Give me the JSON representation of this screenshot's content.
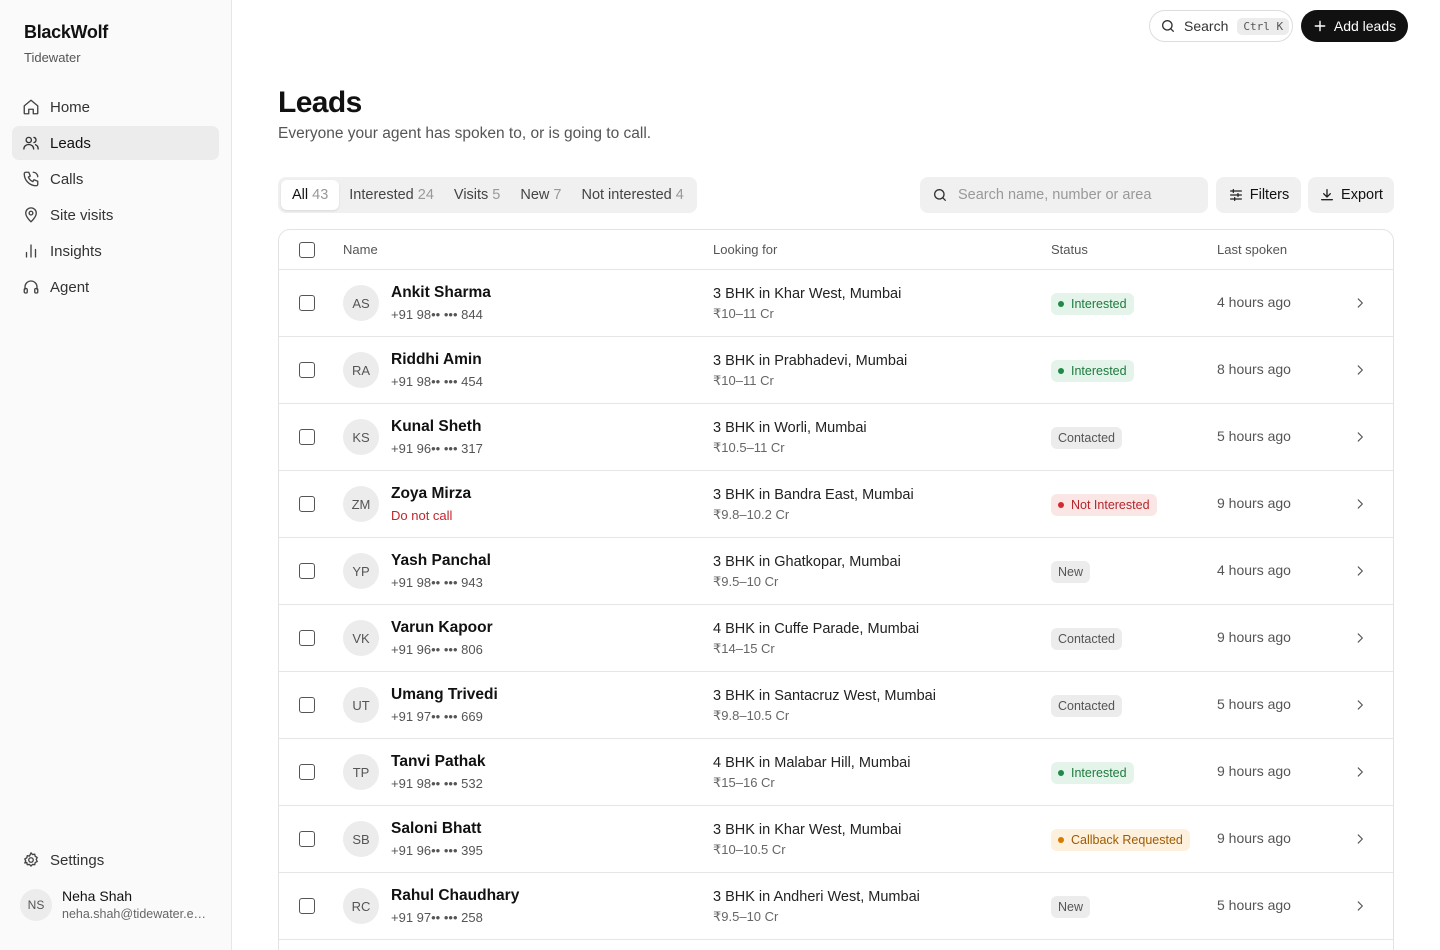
{
  "sidebar": {
    "brand": "BlackWolf",
    "org": "Tidewater",
    "items": [
      {
        "label": "Home",
        "icon": "home-icon"
      },
      {
        "label": "Leads",
        "icon": "users-icon",
        "active": true
      },
      {
        "label": "Calls",
        "icon": "phone-icon"
      },
      {
        "label": "Site visits",
        "icon": "map-pin-icon"
      },
      {
        "label": "Insights",
        "icon": "bar-chart-icon"
      },
      {
        "label": "Agent",
        "icon": "headset-icon"
      }
    ],
    "settings_label": "Settings",
    "user": {
      "initials": "NS",
      "name": "Neha Shah",
      "email": "neha.shah@tidewater.example"
    }
  },
  "topbar": {
    "search_label": "Search",
    "search_shortcut": "Ctrl K",
    "add_label": "Add leads"
  },
  "header": {
    "title": "Leads",
    "subtitle": "Everyone your agent has spoken to, or is going to call."
  },
  "tabs": [
    {
      "label": "All",
      "count": "43",
      "active": true
    },
    {
      "label": "Interested",
      "count": "24"
    },
    {
      "label": "Visits",
      "count": "5"
    },
    {
      "label": "New",
      "count": "7"
    },
    {
      "label": "Not interested",
      "count": "4"
    }
  ],
  "toolbar": {
    "search_placeholder": "Search name, number or area",
    "filters_label": "Filters",
    "export_label": "Export"
  },
  "table": {
    "columns": {
      "name": "Name",
      "looking": "Looking for",
      "status": "Status",
      "last": "Last spoken"
    },
    "rows": [
      {
        "initials": "AS",
        "name": "Ankit Sharma",
        "phone": "+91 98•• ••• 844",
        "looking": "3 BHK in Khar West, Mumbai",
        "budget": "₹10–11 Cr",
        "status": "Interested",
        "status_type": "interested",
        "last": "4 hours ago"
      },
      {
        "initials": "RA",
        "name": "Riddhi Amin",
        "phone": "+91 98•• ••• 454",
        "looking": "3 BHK in Prabhadevi, Mumbai",
        "budget": "₹10–11 Cr",
        "status": "Interested",
        "status_type": "interested",
        "last": "8 hours ago"
      },
      {
        "initials": "KS",
        "name": "Kunal Sheth",
        "phone": "+91 96•• ••• 317",
        "looking": "3 BHK in Worli, Mumbai",
        "budget": "₹10.5–11 Cr",
        "status": "Contacted",
        "status_type": "neutral",
        "last": "5 hours ago"
      },
      {
        "initials": "ZM",
        "name": "Zoya Mirza",
        "phone": "Do not call",
        "dnc": true,
        "looking": "3 BHK in Bandra East, Mumbai",
        "budget": "₹9.8–10.2 Cr",
        "status": "Not Interested",
        "status_type": "notint",
        "last": "9 hours ago"
      },
      {
        "initials": "YP",
        "name": "Yash Panchal",
        "phone": "+91 98•• ••• 943",
        "looking": "3 BHK in Ghatkopar, Mumbai",
        "budget": "₹9.5–10 Cr",
        "status": "New",
        "status_type": "neutral",
        "last": "4 hours ago"
      },
      {
        "initials": "VK",
        "name": "Varun Kapoor",
        "phone": "+91 96•• ••• 806",
        "looking": "4 BHK in Cuffe Parade, Mumbai",
        "budget": "₹14–15 Cr",
        "status": "Contacted",
        "status_type": "neutral",
        "last": "9 hours ago"
      },
      {
        "initials": "UT",
        "name": "Umang Trivedi",
        "phone": "+91 97•• ••• 669",
        "looking": "3 BHK in Santacruz West, Mumbai",
        "budget": "₹9.8–10.5 Cr",
        "status": "Contacted",
        "status_type": "neutral",
        "last": "5 hours ago"
      },
      {
        "initials": "TP",
        "name": "Tanvi Pathak",
        "phone": "+91 98•• ••• 532",
        "looking": "4 BHK in Malabar Hill, Mumbai",
        "budget": "₹15–16 Cr",
        "status": "Interested",
        "status_type": "interested",
        "last": "9 hours ago"
      },
      {
        "initials": "SB",
        "name": "Saloni Bhatt",
        "phone": "+91 96•• ••• 395",
        "looking": "3 BHK in Khar West, Mumbai",
        "budget": "₹10–10.5 Cr",
        "status": "Callback Requested",
        "status_type": "callback",
        "last": "9 hours ago"
      },
      {
        "initials": "RC",
        "name": "Rahul Chaudhary",
        "phone": "+91 97•• ••• 258",
        "looking": "3 BHK in Andheri West, Mumbai",
        "budget": "₹9.5–10 Cr",
        "status": "New",
        "status_type": "neutral",
        "last": "5 hours ago"
      }
    ]
  },
  "colors": {
    "accent": "#111111",
    "interested": "#1e7a3e",
    "not_interested": "#b3262c",
    "callback": "#a05a00"
  }
}
